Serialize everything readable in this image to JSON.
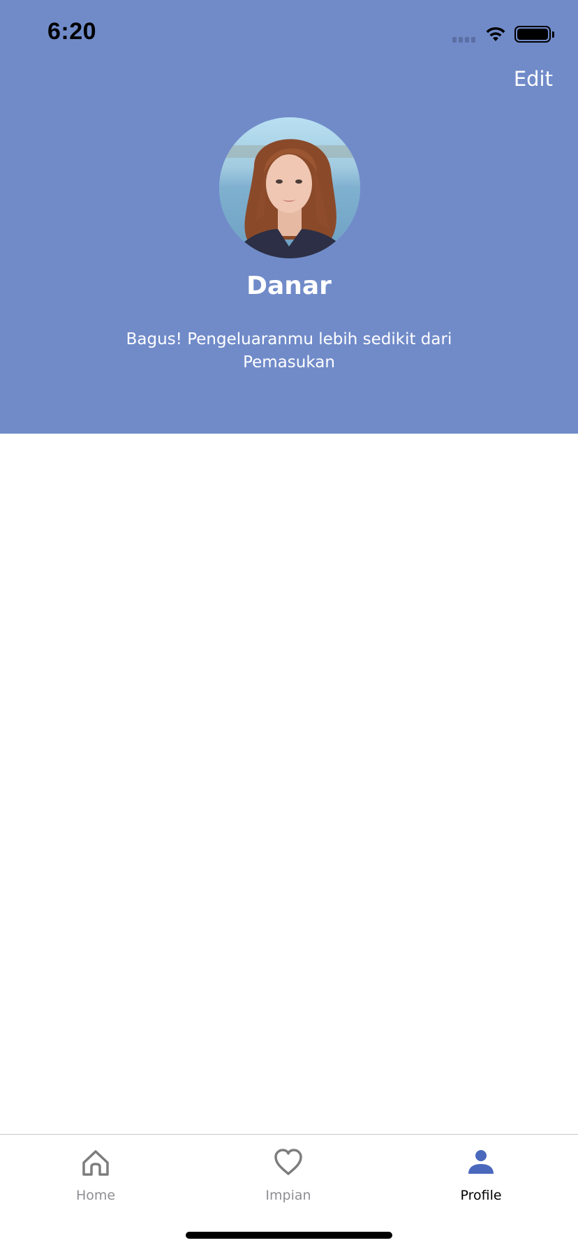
{
  "status_bar": {
    "time": "6:20"
  },
  "header": {
    "edit_label": "Edit",
    "user_name": "Danar",
    "summary": "Bagus! Pengeluaranmu lebih sedikit dari Pemasukan"
  },
  "tabbar": {
    "tabs": [
      {
        "label": "Home",
        "icon": "home-icon",
        "active": false
      },
      {
        "label": "Impian",
        "icon": "heart-icon",
        "active": false
      },
      {
        "label": "Profile",
        "icon": "person-icon",
        "active": true
      }
    ]
  },
  "colors": {
    "header_bg": "#718BC9",
    "active_tab_icon": "#4A69BD",
    "inactive_tab": "#8E8E93"
  }
}
